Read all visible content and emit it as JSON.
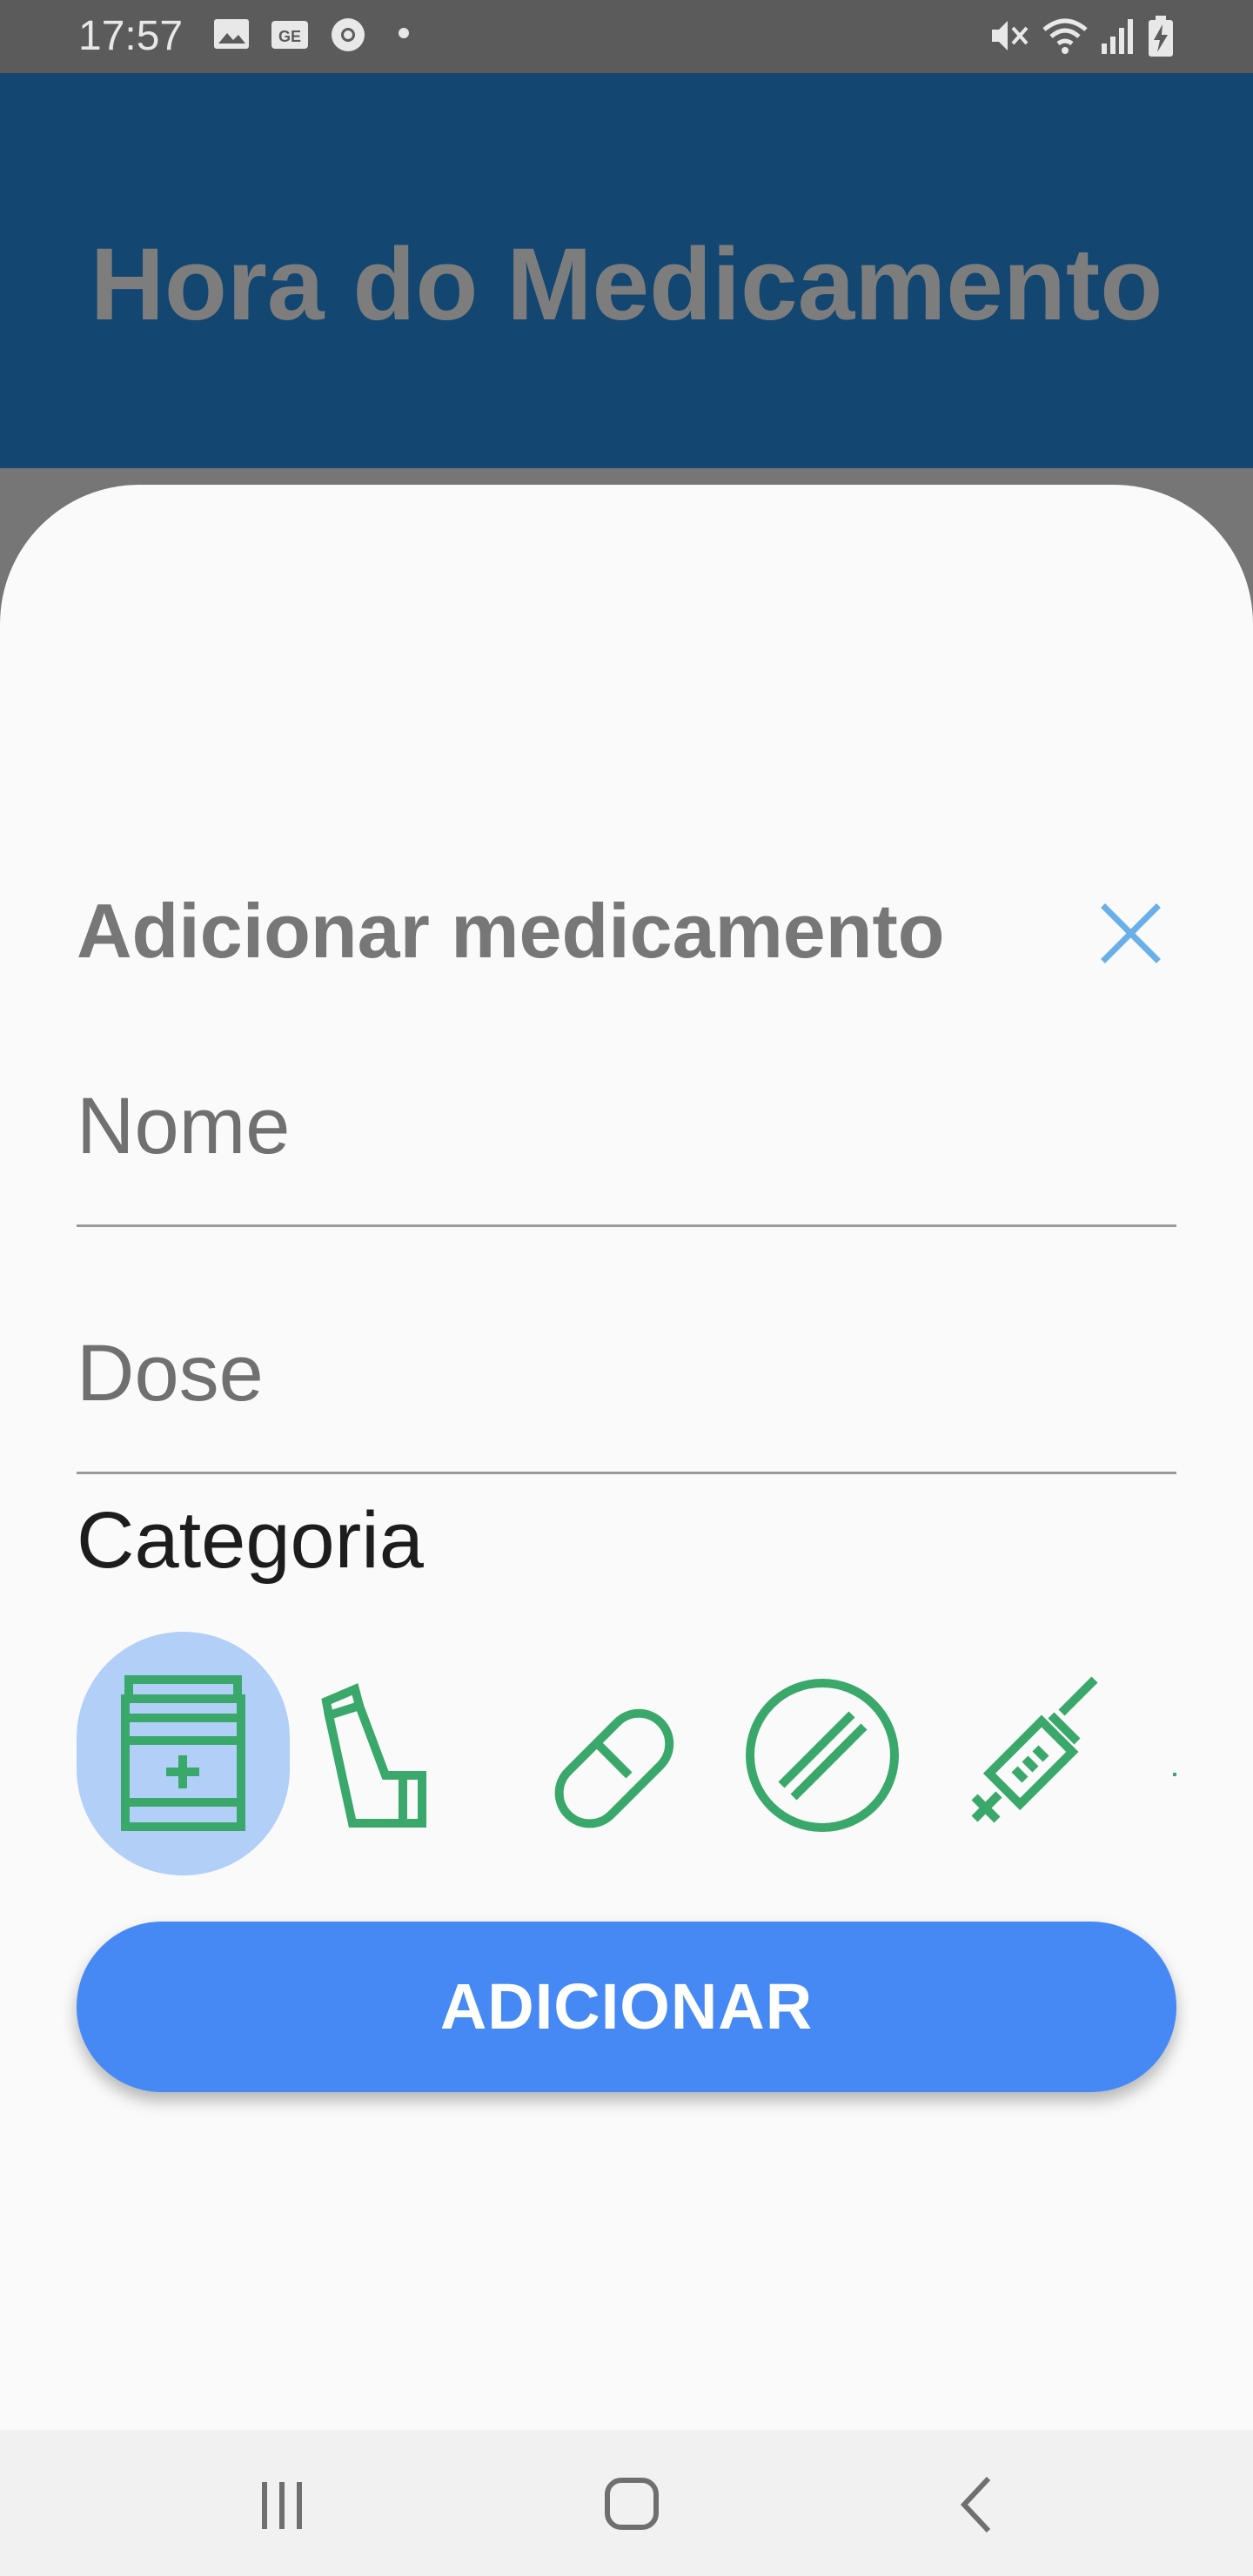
{
  "status_bar": {
    "time": "17:57",
    "icons": [
      "gallery-icon",
      "ge-icon",
      "chrome-icon",
      "dot-icon",
      "mute-icon",
      "wifi-icon",
      "signal-icon",
      "battery-charging-icon"
    ]
  },
  "app_bar": {
    "title": "Hora do Medicamento"
  },
  "sheet": {
    "title": "Adicionar medicamento",
    "close_icon": "close-icon",
    "name_placeholder": "Nome",
    "dose_placeholder": "Dose",
    "category_label": "Categoria",
    "categories": [
      {
        "icon": "medicine-bottle-icon",
        "selected": true
      },
      {
        "icon": "inhaler-icon",
        "selected": false
      },
      {
        "icon": "capsule-icon",
        "selected": false
      },
      {
        "icon": "tablet-icon",
        "selected": false
      },
      {
        "icon": "syringe-icon",
        "selected": false
      }
    ],
    "add_button_label": "ADICIONAR"
  },
  "nav_bar": {
    "buttons": [
      "recent-apps-icon",
      "home-icon",
      "back-icon"
    ]
  },
  "colors": {
    "app_bar": "#134670",
    "accent_blue": "#4689f5",
    "selected_bubble": "#b2cff8",
    "category_icon": "#3aa86a",
    "close_icon": "#6ab0e8"
  }
}
